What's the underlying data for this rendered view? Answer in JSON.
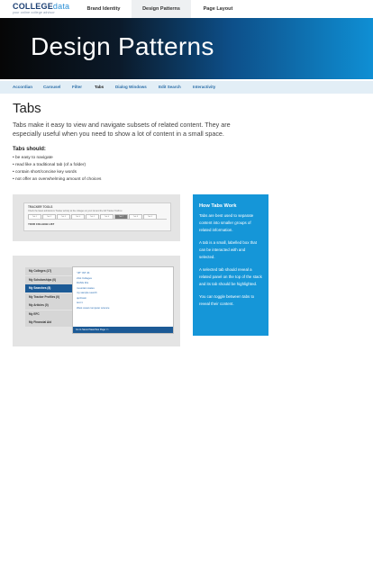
{
  "header": {
    "logo_main": "COLLEGE",
    "logo_accent": "data",
    "logo_tagline": "your online college advisor",
    "nav": [
      {
        "label": "Brand Identity",
        "active": false
      },
      {
        "label": "Design Patterns",
        "active": true
      },
      {
        "label": "Page Layout",
        "active": false
      }
    ]
  },
  "hero": {
    "title": "Design Patterns"
  },
  "subnav": [
    {
      "label": "Accordian",
      "active": false
    },
    {
      "label": "Carousel",
      "active": false
    },
    {
      "label": "Filter",
      "active": false
    },
    {
      "label": "Tabs",
      "active": true
    },
    {
      "label": "Dialog Windows",
      "active": false
    },
    {
      "label": "Edit Search",
      "active": false
    },
    {
      "label": "Interactivity",
      "active": false
    }
  ],
  "page": {
    "title": "Tabs",
    "intro": "Tabs make it easy to view and navigate subsets of related content. They are especially useful when you need to show a lot of content in a small space.",
    "should_title": "Tabs should:",
    "should_items": [
      "be easy to navigate",
      "read like a traditional tab (of a folder)",
      "contain short/concise key words",
      "not offer an overwhelming amount of choices"
    ]
  },
  "example1": {
    "title": "TRACKER TOOLS",
    "desc": "Check the latest admissions Tracker activity at the colleges on your list and the full Tracker Toolbox",
    "tabs": [
      "Tab 1",
      "Tab 2",
      "Tab 3",
      "Tab 4",
      "Tab 5",
      "Tab 6",
      "Tab 7",
      "Tab 8",
      "Tab 9"
    ],
    "selected_tab": "Tab 7",
    "college_label": "YOUR COLLEGE LIST"
  },
  "example2": {
    "tabs": [
      {
        "label": "My Colleges (17)",
        "selected": false
      },
      {
        "label": "My Scholarships (0)",
        "selected": false
      },
      {
        "label": "My Searches (8)",
        "selected": true
      },
      {
        "label": "My Tracker Profiles (0)",
        "selected": false
      },
      {
        "label": "My Articles (0)",
        "selected": false
      },
      {
        "label": "My EFC",
        "selected": false
      },
      {
        "label": "My Financial Aid",
        "selected": false
      }
    ],
    "links": [
      "\"JP\" INT JK",
      "21st Colleges",
      "DANG this",
      "mountain states",
      "my sample search",
      "quiztown",
      "test 1",
      "West coast computer science"
    ],
    "footer": "Go to Saved Searches Page >>"
  },
  "callout": {
    "title": "How Tabs Work",
    "paragraphs": [
      "Tabs are best used to separate content into smaller groups of related information.",
      "A tab is a small, labelled box that can be interacted with and selected.",
      "A selected tab should reveal a related panel on the top of the stack and its tab should be highlighted.",
      "You can toggle between tabs to reveal their content."
    ]
  },
  "colors": {
    "brand_blue": "#1b3f73",
    "accent_blue": "#1596d8",
    "selected_tab": "#1c5a96",
    "link_blue": "#2a6db3"
  }
}
